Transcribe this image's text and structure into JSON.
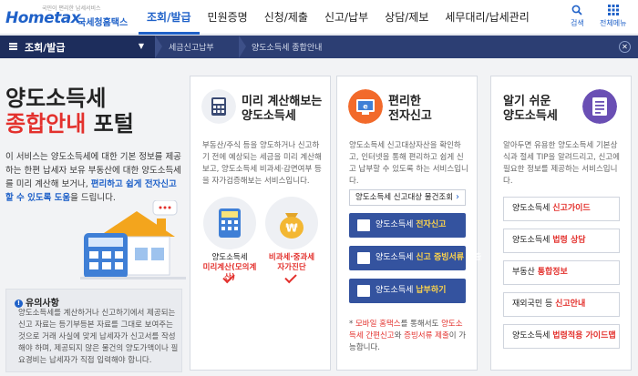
{
  "header": {
    "logo_tagline": "국민이 편리한 납세서비스",
    "logo_main": "Hometax",
    "logo_sub": "국세청홈택스",
    "nav": [
      "조회/발급",
      "민원증명",
      "신청/제출",
      "신고/납부",
      "상담/제보",
      "세무대리/납세관리"
    ],
    "search_label": "검색",
    "menu_label": "전체메뉴"
  },
  "breadcrumb": {
    "menu_label": "조회/발급",
    "items": [
      "세금신고납부",
      "양도소득세 종합안내"
    ]
  },
  "hero": {
    "title_line1": "양도소득세",
    "title_red": "종합안내",
    "title_rest": " 포털",
    "desc_before": "이 서비스는 양도소득세에 대한 기본 정보를 제공하는 한편 납세자 보유 부동산에 대한 양도소득세를 미리 계산해 보거나, ",
    "desc_highlight": "편리하고 쉽게 전자신고할 수 있도록 도움",
    "desc_after": "을 드립니다."
  },
  "notice": {
    "title": "유의사항",
    "text": "양도소득세를 계산하거나 신고하기에서 제공되는 신고 자료는 등기부등본 자료를 그대로 보여주는 것으로 거래 사실에 맞게 납세자가 신고서를 작성해야 하며, 제공되지 않은 물건의 양도가액이나 필요경비는 납세자가 직접 입력해야 합니다."
  },
  "card1": {
    "title_line1": "미리 계산해보는",
    "title_line2": "양도소득세",
    "desc": "부동산/주식 등을 양도하거나 신고하기 전에 예상되는 세금을 미리 계산해보고, 양도소득세 비과세·감면여부 등을 자가검증해보는 서비스입니다.",
    "item1_line1": "양도소득세",
    "item1_line2": "미리계산(모의계산)",
    "item2_line1": "비과세·중과세",
    "item2_line2": "자가진단"
  },
  "card2": {
    "title_line1": "편리한",
    "title_line2": "전자신고",
    "desc": "양도소득세 신고대상자산을 확인하고, 인터넷을 통해 편리하고 쉽게 신고 납부할 수 있도록 하는 서비스입니다.",
    "search_btn": "양도소득세 신고대상 물건조회",
    "btn1_pre": "양도소득세 ",
    "btn1_hl": "전자신고",
    "btn2_pre": "양도소득세 ",
    "btn2_hl": "신고 증빙서류",
    "btn2_post": " 제출",
    "btn3_pre": "양도소득세 ",
    "btn3_hl": "납부하기",
    "mobile_pre": "* ",
    "mobile_r1": "모바일 홈택스",
    "mobile_mid": "를 통해서도 ",
    "mobile_r2": "양도소득세 간편신고",
    "mobile_and": "와 ",
    "mobile_r3": "증빙서류 제출",
    "mobile_post": "이 가능합니다."
  },
  "card3": {
    "title_line1": "알기 쉬운",
    "title_line2": "양도소득세",
    "desc": "알아두면 유용한 양도소득세 기본상식과 절세 TIP을 알려드리고, 신고에 필요한 정보를 제공하는 서비스입니다.",
    "items": [
      {
        "pre": "양도소득세 ",
        "hl": "신고가이드"
      },
      {
        "pre": "양도소득세 ",
        "hl": "법령 상담"
      },
      {
        "pre": "부동산 ",
        "hl": "통합정보"
      },
      {
        "pre": "재외국민 등 ",
        "hl": "신고안내"
      },
      {
        "pre": "양도소득세 ",
        "hl": "법령적용 가이드맵"
      }
    ]
  },
  "colors": {
    "primary": "#1f61c8",
    "navy": "#2c3e73",
    "accent_red": "#e3312d",
    "button_blue": "#34539f"
  }
}
